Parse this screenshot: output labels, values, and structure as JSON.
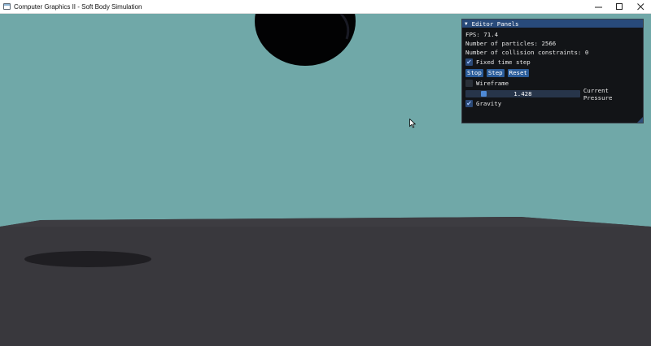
{
  "window": {
    "title": "Computer Graphics II - Soft Body Simulation",
    "icons": {
      "app": "window-app-icon",
      "minimize": "minimize-icon",
      "maximize": "maximize-icon",
      "close": "close-icon"
    }
  },
  "colors": {
    "sky": "#70a8a8",
    "floor": "#39383d",
    "sphere": "#000000",
    "panel_bg": "#121417",
    "panel_header": "#284a7a",
    "accent": "#4f8ad6"
  },
  "panel": {
    "title": "Editor Panels",
    "fps_label": "FPS: 71.4",
    "particles_label": "Number of particles: 2566",
    "constraints_label": "Number of collision constraints: 0",
    "fixed_time_step": {
      "label": "Fixed time step",
      "checked": true
    },
    "buttons": {
      "stop": "Stop",
      "step": "Step",
      "reset": "Reset"
    },
    "wireframe": {
      "label": "Wireframe",
      "checked": false
    },
    "pressure": {
      "value": "1.428",
      "label": "Current Pressure",
      "fraction": 0.14
    },
    "gravity": {
      "label": "Gravity",
      "checked": true
    }
  }
}
